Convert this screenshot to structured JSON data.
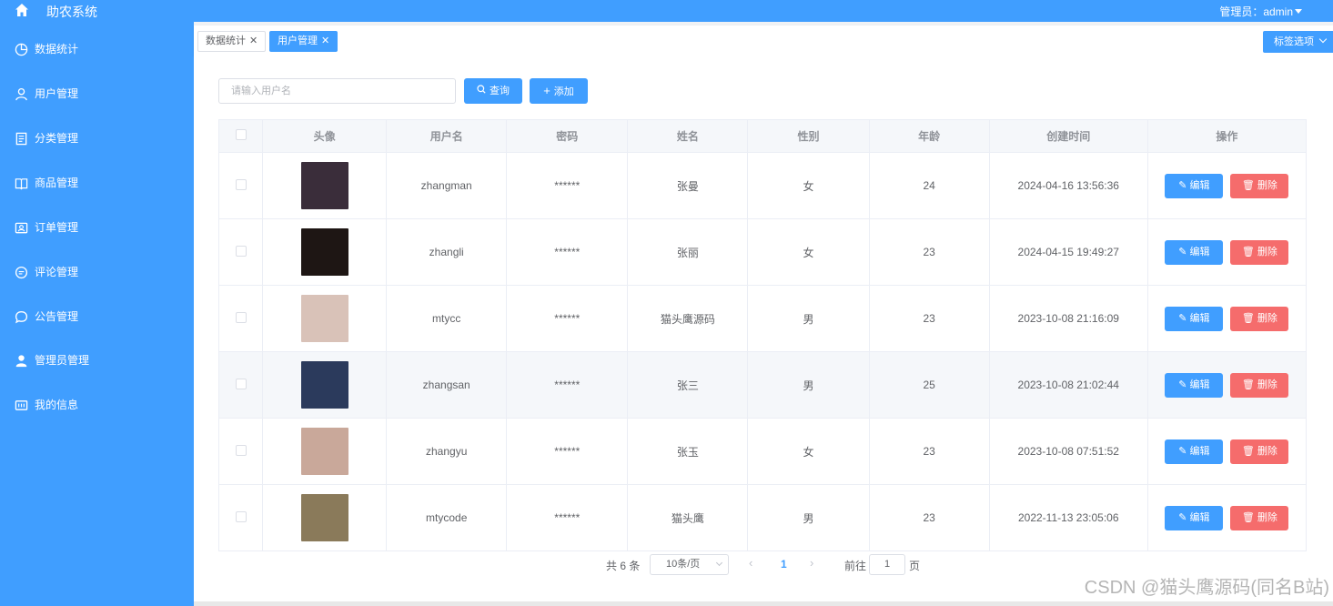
{
  "app": {
    "title": "助农系统",
    "user_label": "管理员：admin"
  },
  "sidebar": {
    "items": [
      {
        "label": "数据统计",
        "icon": "pie-chart-icon"
      },
      {
        "label": "用户管理",
        "icon": "user-icon"
      },
      {
        "label": "分类管理",
        "icon": "document-icon"
      },
      {
        "label": "商品管理",
        "icon": "book-icon"
      },
      {
        "label": "订单管理",
        "icon": "order-icon"
      },
      {
        "label": "评论管理",
        "icon": "chat-icon"
      },
      {
        "label": "公告管理",
        "icon": "message-icon"
      },
      {
        "label": "管理员管理",
        "icon": "admin-user-icon"
      },
      {
        "label": "我的信息",
        "icon": "info-card-icon"
      }
    ]
  },
  "tabs": [
    {
      "label": "数据统计",
      "active": false
    },
    {
      "label": "用户管理",
      "active": true
    }
  ],
  "tab_options": "标签选项",
  "toolbar": {
    "search_placeholder": "请输入用户名",
    "search_value": "",
    "query_label": "查询",
    "add_label": "添加"
  },
  "table": {
    "headers": [
      "",
      "头像",
      "用户名",
      "密码",
      "姓名",
      "性别",
      "年龄",
      "创建时间",
      "操作"
    ],
    "rows": [
      {
        "username": "zhangman",
        "password": "******",
        "name": "张曼",
        "gender": "女",
        "age": "24",
        "created": "2024-04-16 13:56:36",
        "avatar_color": "#3a2d3a"
      },
      {
        "username": "zhangli",
        "password": "******",
        "name": "张丽",
        "gender": "女",
        "age": "23",
        "created": "2024-04-15 19:49:27",
        "avatar_color": "#1e1614"
      },
      {
        "username": "mtycc",
        "password": "******",
        "name": "猫头鹰源码",
        "gender": "男",
        "age": "23",
        "created": "2023-10-08 21:16:09",
        "avatar_color": "#d9c2b8"
      },
      {
        "username": "zhangsan",
        "password": "******",
        "name": "张三",
        "gender": "男",
        "age": "25",
        "created": "2023-10-08 21:02:44",
        "avatar_color": "#2b3a5c"
      },
      {
        "username": "zhangyu",
        "password": "******",
        "name": "张玉",
        "gender": "女",
        "age": "23",
        "created": "2023-10-08 07:51:52",
        "avatar_color": "#c9a89a"
      },
      {
        "username": "mtycode",
        "password": "******",
        "name": "猫头鹰",
        "gender": "男",
        "age": "23",
        "created": "2022-11-13 23:05:06",
        "avatar_color": "#8a7a5a"
      }
    ],
    "edit_label": "编辑",
    "delete_label": "删除"
  },
  "pagination": {
    "total": "共 6 条",
    "page_size": "10条/页",
    "current_page": "1",
    "goto_label": "前往",
    "goto_value": "1",
    "page_label": "页"
  },
  "watermark": "CSDN @猫头鹰源码(同名B站)",
  "colors": {
    "primary": "#409eff",
    "danger": "#f56c6c"
  }
}
